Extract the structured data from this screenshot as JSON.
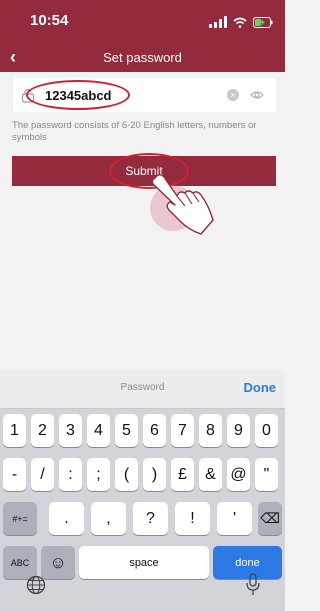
{
  "status_bar": {
    "time": "10:54"
  },
  "nav": {
    "back": "‹",
    "title": "Set password"
  },
  "form": {
    "password_value": "12345abcd",
    "clear_symbol": "×",
    "hint": "The password consists of 6-20 English letters, numbers or symbols",
    "submit_label": "Submit"
  },
  "keyboard": {
    "bar_label": "Password",
    "done_link": "Done",
    "row1": [
      "1",
      "2",
      "3",
      "4",
      "5",
      "6",
      "7",
      "8",
      "9",
      "0"
    ],
    "row2": [
      "-",
      "/",
      ":",
      ";",
      "(",
      ")",
      "£",
      "&",
      "@",
      "\""
    ],
    "row3_left": "#+=",
    "row3": [
      ".",
      ",",
      "?",
      "!",
      "'"
    ],
    "delete_symbol": "⌫",
    "abc": "ABC",
    "emoji": "☺",
    "space": "space",
    "done": "done"
  },
  "colors": {
    "brand": "#932a3e",
    "highlight_circle": "#d1202f",
    "keyboard_done": "#2b7ae3"
  },
  "icons": [
    "lock-icon",
    "clear-icon",
    "eye-icon",
    "hand-pointer-icon",
    "globe-icon",
    "microphone-icon",
    "signal-icon",
    "wifi-icon",
    "battery-icon"
  ]
}
